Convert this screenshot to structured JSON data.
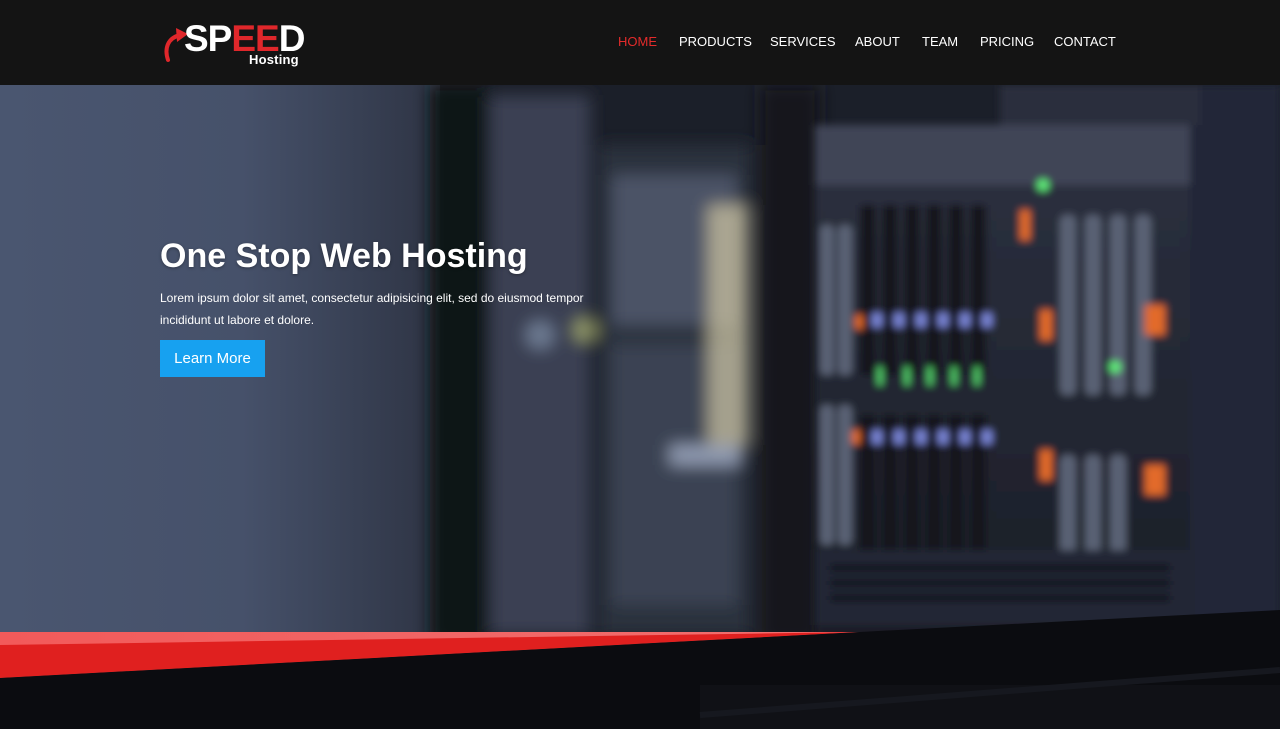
{
  "brand": {
    "name_prefix": "SP",
    "name_accent": "EE",
    "name_suffix": "D",
    "tagline": "Hosting",
    "arrow_icon": "curved-arrow-icon",
    "accent_color": "#e0272b"
  },
  "nav": {
    "items": [
      {
        "label": "HOME",
        "active": true
      },
      {
        "label": "PRODUCTS",
        "active": false
      },
      {
        "label": "SERVICES",
        "active": false
      },
      {
        "label": "ABOUT",
        "active": false
      },
      {
        "label": "TEAM",
        "active": false
      },
      {
        "label": "PRICING",
        "active": false
      },
      {
        "label": "CONTACT",
        "active": false
      }
    ],
    "active_color": "#e32b2b"
  },
  "hero": {
    "title": "One Stop Web Hosting",
    "text": "Lorem ipsum dolor sit amet, consectetur adipisicing elit, sed do eiusmod tempor incididunt ut labore et dolore.",
    "button_label": "Learn More",
    "button_color": "#17a1f0",
    "background_image": "server-rack-photo",
    "band_color": "#e0201f"
  }
}
